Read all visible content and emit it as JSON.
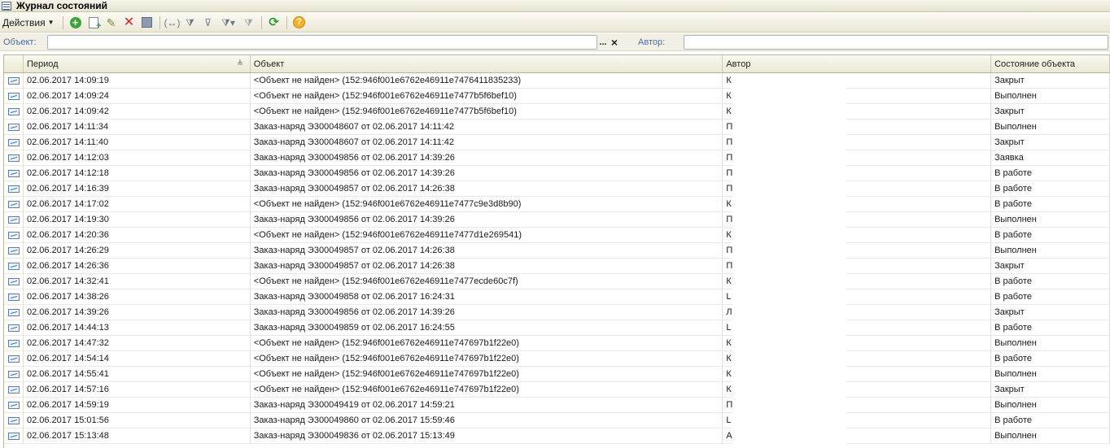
{
  "window": {
    "title": "Журнал состояний"
  },
  "toolbar": {
    "actions_label": "Действия",
    "buttons": [
      "add-icon",
      "copy-icon",
      "edit-icon",
      "delete-icon",
      "save-icon",
      "link-icon",
      "filter-icon",
      "filter-list-icon",
      "filter-dropdown-icon",
      "filter-clear-icon",
      "refresh-icon",
      "help-icon"
    ]
  },
  "filter": {
    "object_label": "Объект:",
    "object_value": "",
    "select_button": "...",
    "clear_button": "×",
    "author_label": "Автор:",
    "author_value": ""
  },
  "table": {
    "columns": [
      "",
      "Период",
      "Объект",
      "Автор",
      "Состояние объекта"
    ],
    "rows": [
      {
        "period": "02.06.2017 14:09:19",
        "object": "<Объект не найден> (152:946f001e6762e46911e7476411835233)",
        "author": "К",
        "state": "Закрыт"
      },
      {
        "period": "02.06.2017 14:09:24",
        "object": "<Объект не найден> (152:946f001e6762e46911e7477b5f6bef10)",
        "author": "К",
        "state": "Выполнен"
      },
      {
        "period": "02.06.2017 14:09:42",
        "object": "<Объект не найден> (152:946f001e6762e46911e7477b5f6bef10)",
        "author": "К",
        "state": "Закрыт"
      },
      {
        "period": "02.06.2017 14:11:34",
        "object": "Заказ-наряд Э300048607 от 02.06.2017 14:11:42",
        "author": "П",
        "state": "Выполнен"
      },
      {
        "period": "02.06.2017 14:11:40",
        "object": "Заказ-наряд Э300048607 от 02.06.2017 14:11:42",
        "author": "П",
        "state": "Закрыт"
      },
      {
        "period": "02.06.2017 14:12:03",
        "object": "Заказ-наряд Э300049856 от 02.06.2017 14:39:26",
        "author": "П",
        "state": "Заявка"
      },
      {
        "period": "02.06.2017 14:12:18",
        "object": "Заказ-наряд Э300049856 от 02.06.2017 14:39:26",
        "author": "П",
        "state": "В работе"
      },
      {
        "period": "02.06.2017 14:16:39",
        "object": "Заказ-наряд Э300049857 от 02.06.2017 14:26:38",
        "author": "П",
        "state": "В работе"
      },
      {
        "period": "02.06.2017 14:17:02",
        "object": "<Объект не найден> (152:946f001e6762e46911e7477c9e3d8b90)",
        "author": "К",
        "state": "В работе"
      },
      {
        "period": "02.06.2017 14:19:30",
        "object": "Заказ-наряд Э300049856 от 02.06.2017 14:39:26",
        "author": "П",
        "state": "Выполнен"
      },
      {
        "period": "02.06.2017 14:20:36",
        "object": "<Объект не найден> (152:946f001e6762e46911e7477d1e269541)",
        "author": "К",
        "state": "В работе"
      },
      {
        "period": "02.06.2017 14:26:29",
        "object": "Заказ-наряд Э300049857 от 02.06.2017 14:26:38",
        "author": "П",
        "state": "Выполнен"
      },
      {
        "period": "02.06.2017 14:26:36",
        "object": "Заказ-наряд Э300049857 от 02.06.2017 14:26:38",
        "author": "П",
        "state": "Закрыт"
      },
      {
        "period": "02.06.2017 14:32:41",
        "object": "<Объект не найден> (152:946f001e6762e46911e7477ecde60c7f)",
        "author": "К",
        "state": "В работе"
      },
      {
        "period": "02.06.2017 14:38:26",
        "object": "Заказ-наряд Э300049858 от 02.06.2017 16:24:31",
        "author": "L",
        "state": "В работе"
      },
      {
        "period": "02.06.2017 14:39:26",
        "object": "Заказ-наряд Э300049856 от 02.06.2017 14:39:26",
        "author": "Л",
        "state": "Закрыт"
      },
      {
        "period": "02.06.2017 14:44:13",
        "object": "Заказ-наряд Э300049859 от 02.06.2017 16:24:55",
        "author": "L",
        "state": "В работе"
      },
      {
        "period": "02.06.2017 14:47:32",
        "object": "<Объект не найден> (152:946f001e6762e46911e747697b1f22e0)",
        "author": "К",
        "state": "Выполнен"
      },
      {
        "period": "02.06.2017 14:54:14",
        "object": "<Объект не найден> (152:946f001e6762e46911e747697b1f22e0)",
        "author": "К",
        "state": "В работе"
      },
      {
        "period": "02.06.2017 14:55:41",
        "object": "<Объект не найден> (152:946f001e6762e46911e747697b1f22e0)",
        "author": "К",
        "state": "Выполнен"
      },
      {
        "period": "02.06.2017 14:57:16",
        "object": "<Объект не найден> (152:946f001e6762e46911e747697b1f22e0)",
        "author": "К",
        "state": "Закрыт"
      },
      {
        "period": "02.06.2017 14:59:19",
        "object": "Заказ-наряд Э300049419 от 02.06.2017 14:59:21",
        "author": "П",
        "state": "Выполнен"
      },
      {
        "period": "02.06.2017 15:01:56",
        "object": "Заказ-наряд Э300049860 от 02.06.2017 15:59:46",
        "author": "L",
        "state": "В работе"
      },
      {
        "period": "02.06.2017 15:13:48",
        "object": "Заказ-наряд Э300049836 от 02.06.2017 15:13:49",
        "author": "А",
        "state": "Выполнен"
      }
    ]
  }
}
